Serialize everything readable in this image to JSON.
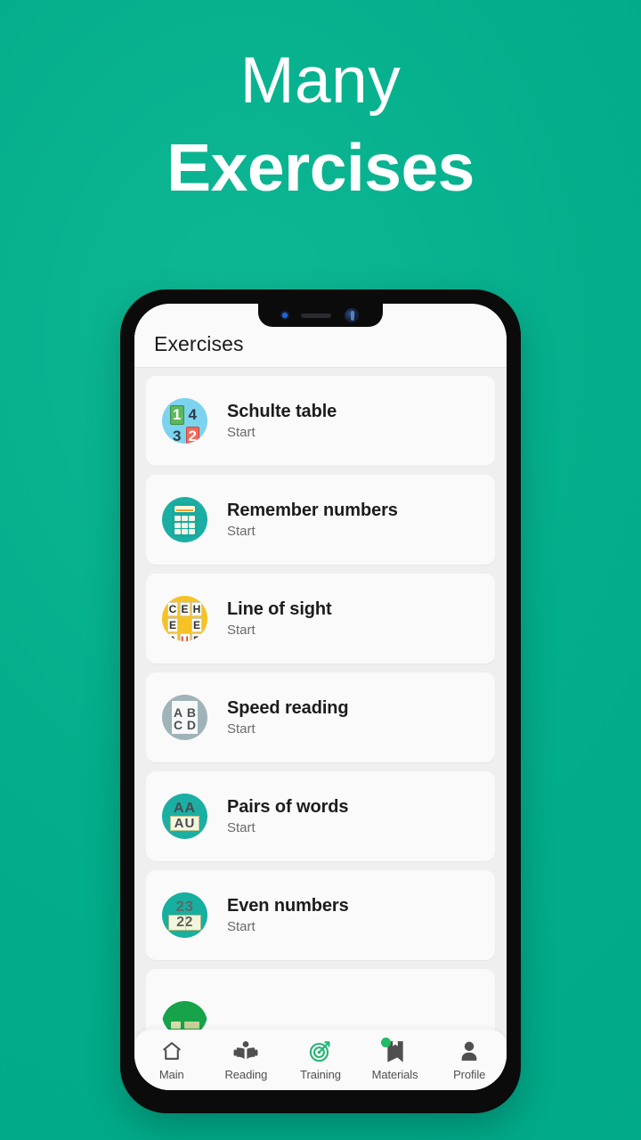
{
  "promo": {
    "line1": "Many",
    "line2": "Exercises"
  },
  "app": {
    "appbar": {
      "title": "Exercises"
    },
    "exercises": [
      {
        "name": "Schulte table",
        "action": "Start",
        "icon": "schulte-table-icon",
        "icon_tiles": [
          "1",
          "4",
          "3",
          "2"
        ],
        "icon_bg": "#7BD3F0"
      },
      {
        "name": "Remember numbers",
        "action": "Start",
        "icon": "calculator-icon",
        "icon_bg": "#1BAFA4"
      },
      {
        "name": "Line of sight",
        "action": "Start",
        "icon": "letter-grid-icon",
        "icon_letters": [
          "C",
          "E",
          "H",
          "E",
          "",
          "E",
          "A",
          "U",
          "P"
        ],
        "icon_bg": "#F5C326"
      },
      {
        "name": "Speed reading",
        "action": "Start",
        "icon": "abcd-page-icon",
        "icon_letters": [
          "A",
          "B",
          "C",
          "D"
        ],
        "icon_bg": "#9FB3B8"
      },
      {
        "name": "Pairs of words",
        "action": "Start",
        "icon": "word-pairs-icon",
        "icon_top": "AA",
        "icon_box": "AU",
        "icon_bg": "#1BAFA4"
      },
      {
        "name": "Even numbers",
        "action": "Start",
        "icon": "even-numbers-icon",
        "icon_top": "23",
        "icon_box": "22",
        "icon_bg": "#16AFA0"
      }
    ],
    "bottom_nav": [
      {
        "label": "Main",
        "icon": "home-icon",
        "active": false,
        "badge": false
      },
      {
        "label": "Reading",
        "icon": "reading-icon",
        "active": false,
        "badge": false
      },
      {
        "label": "Training",
        "icon": "target-icon",
        "active": true,
        "badge": false
      },
      {
        "label": "Materials",
        "icon": "bookmark-icon",
        "active": false,
        "badge": true
      },
      {
        "label": "Profile",
        "icon": "person-icon",
        "active": false,
        "badge": false
      }
    ]
  },
  "colors": {
    "background": "#03AE8C",
    "accent": "#22BB66",
    "card": "#FAFAFA",
    "list_bg": "#EFEFEF"
  }
}
